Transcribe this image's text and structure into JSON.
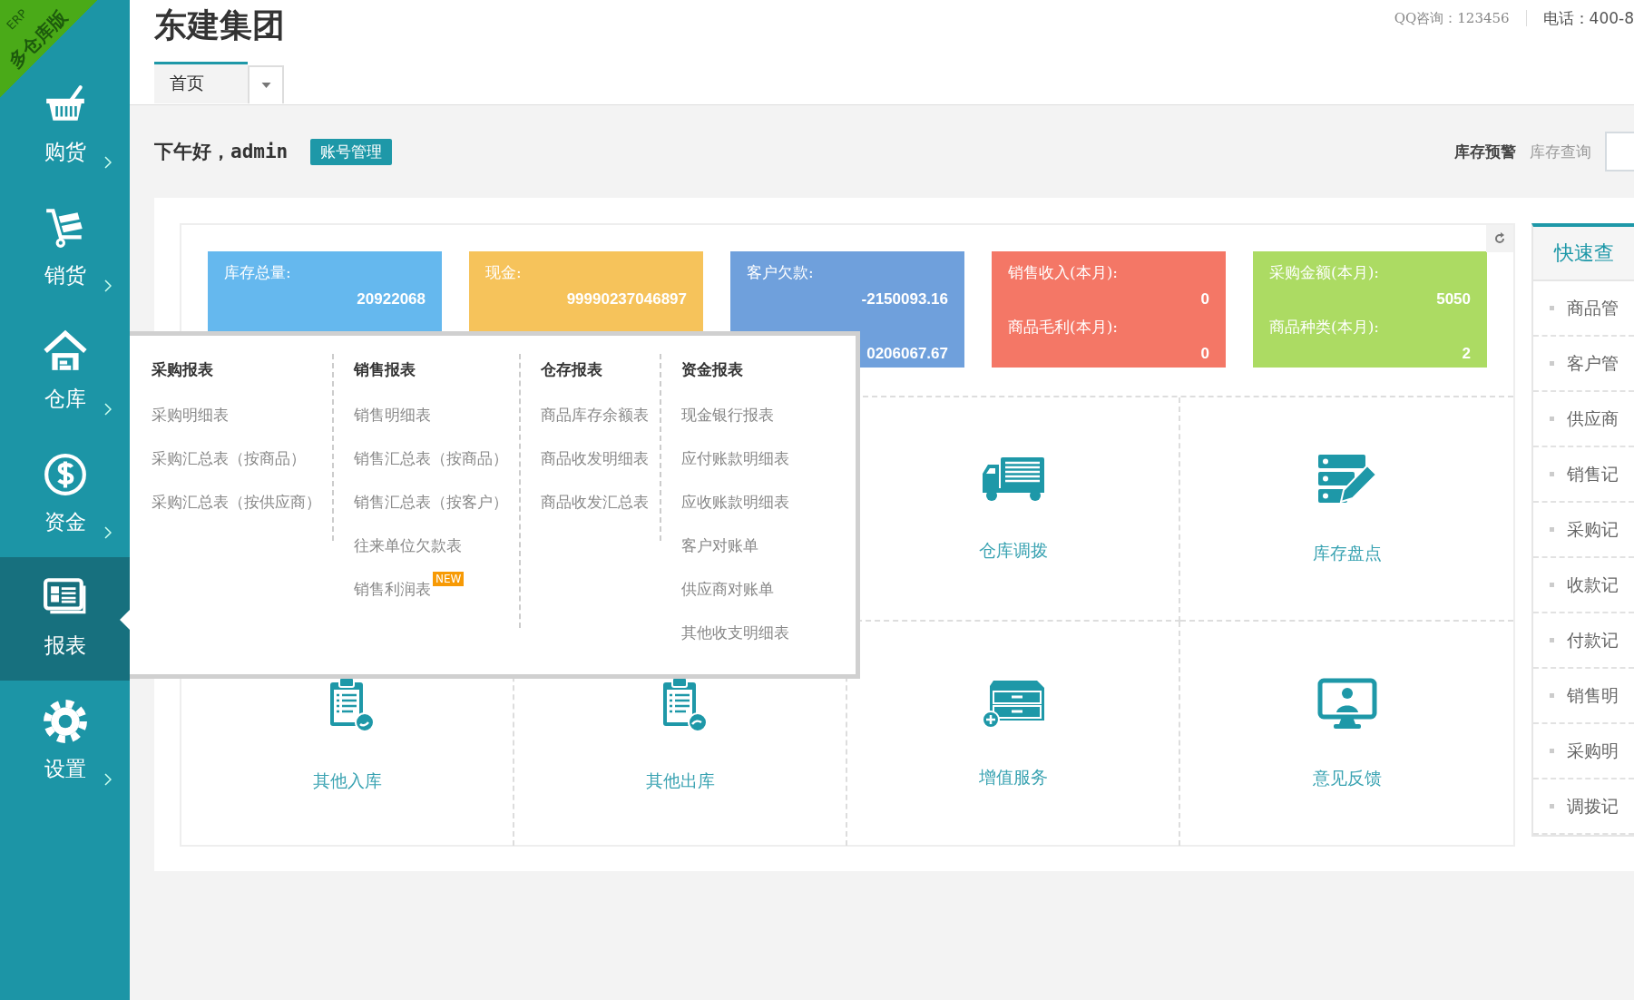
{
  "ribbon": {
    "small": "ERP",
    "label": "多仓库版"
  },
  "sidebar": {
    "items": [
      {
        "kind": "basket",
        "label": "购货",
        "selected": false
      },
      {
        "kind": "cart",
        "label": "销货",
        "selected": false
      },
      {
        "kind": "house",
        "label": "仓库",
        "selected": false
      },
      {
        "kind": "dollar",
        "label": "资金",
        "selected": false
      },
      {
        "kind": "report",
        "label": "报表",
        "selected": true
      },
      {
        "kind": "gear",
        "label": "设置",
        "selected": false
      }
    ]
  },
  "header": {
    "title": "东建集团",
    "contact": [
      "QQ咨询：123456",
      "电话：400-8"
    ],
    "tabs": [
      {
        "label": "首页",
        "selected": true
      }
    ]
  },
  "greeting": {
    "text": "下午好，admin",
    "account_button": "账号管理",
    "links": [
      {
        "label": "库存预警",
        "selected": true
      },
      {
        "label": "库存查询",
        "selected": false
      }
    ]
  },
  "stats": [
    {
      "color": "#65b8ee",
      "rows": [
        {
          "label": "库存总量:",
          "value": "20922068"
        }
      ]
    },
    {
      "color": "#f6c35b",
      "rows": [
        {
          "label": "现金:",
          "value": "99990237046897"
        }
      ]
    },
    {
      "color": "#6fa0dc",
      "rows": [
        {
          "label": "客户欠款:",
          "value": "-2150093.16"
        },
        {
          "value": "0206067.67"
        }
      ]
    },
    {
      "color": "#f47766",
      "rows": [
        {
          "label": "销售收入(本月):",
          "value": "0"
        },
        {
          "label": "商品毛利(本月):",
          "value": "0"
        }
      ]
    },
    {
      "color": "#acdb63",
      "rows": [
        {
          "label": "采购金额(本月):",
          "value": "5050"
        },
        {
          "label": "商品种类(本月):",
          "value": "2"
        }
      ]
    }
  ],
  "tiles": [
    {
      "kind": "truck",
      "label": "仓库调拨"
    },
    {
      "kind": "server-edit",
      "label": "库存盘点"
    },
    {
      "kind": "clipboard-in",
      "label": "其他入库"
    },
    {
      "kind": "clipboard-out",
      "label": "其他出库"
    },
    {
      "kind": "drawer-add",
      "label": "增值服务"
    },
    {
      "kind": "monitor-user",
      "label": "意见反馈"
    }
  ],
  "quick_view": {
    "title": "快速查",
    "items": [
      "商品管",
      "客户管",
      "供应商",
      "销售记",
      "采购记",
      "收款记",
      "付款记",
      "销售明",
      "采购明",
      "调拨记"
    ]
  },
  "report_menu": {
    "columns": [
      {
        "title": "采购报表",
        "items": [
          {
            "label": "采购明细表"
          },
          {
            "label": "采购汇总表（按商品）"
          },
          {
            "label": "采购汇总表（按供应商）"
          }
        ]
      },
      {
        "title": "销售报表",
        "items": [
          {
            "label": "销售明细表"
          },
          {
            "label": "销售汇总表（按商品）"
          },
          {
            "label": "销售汇总表（按客户）"
          },
          {
            "label": "往来单位欠款表"
          },
          {
            "label": "销售利润表",
            "badge": "NEW"
          }
        ]
      },
      {
        "title": "仓存报表",
        "items": [
          {
            "label": "商品库存余额表"
          },
          {
            "label": "商品收发明细表"
          },
          {
            "label": "商品收发汇总表"
          }
        ]
      },
      {
        "title": "资金报表",
        "items": [
          {
            "label": "现金银行报表"
          },
          {
            "label": "应付账款明细表"
          },
          {
            "label": "应收账款明细表"
          },
          {
            "label": "客户对账单"
          },
          {
            "label": "供应商对账单"
          },
          {
            "label": "其他收支明细表"
          }
        ]
      }
    ]
  }
}
